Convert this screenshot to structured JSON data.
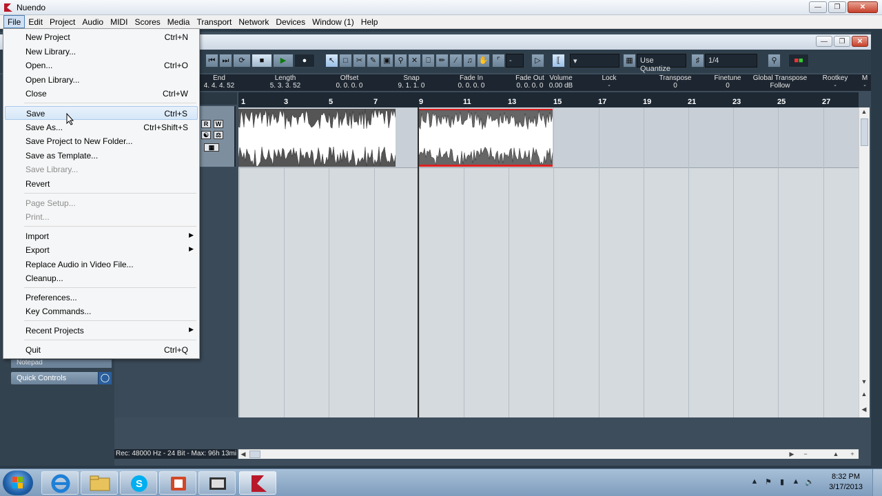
{
  "app": {
    "title": "Nuendo"
  },
  "menubar": {
    "items": [
      "File",
      "Edit",
      "Project",
      "Audio",
      "MIDI",
      "Scores",
      "Media",
      "Transport",
      "Network",
      "Devices",
      "Window (1)",
      "Help"
    ],
    "active": "File"
  },
  "file_menu": {
    "items": [
      {
        "label": "New Project",
        "shortcut": "Ctrl+N"
      },
      {
        "label": "New Library...",
        "shortcut": ""
      },
      {
        "label": "Open...",
        "shortcut": "Ctrl+O"
      },
      {
        "label": "Open Library...",
        "shortcut": ""
      },
      {
        "label": "Close",
        "shortcut": "Ctrl+W"
      },
      {
        "label": "Save",
        "shortcut": "Ctrl+S"
      },
      {
        "label": "Save As...",
        "shortcut": "Ctrl+Shift+S"
      },
      {
        "label": "Save Project to New Folder...",
        "shortcut": ""
      },
      {
        "label": "Save as Template...",
        "shortcut": ""
      },
      {
        "label": "Save Library...",
        "shortcut": ""
      },
      {
        "label": "Revert",
        "shortcut": ""
      },
      {
        "label": "Page Setup...",
        "shortcut": ""
      },
      {
        "label": "Print...",
        "shortcut": ""
      },
      {
        "label": "Import",
        "shortcut": ""
      },
      {
        "label": "Export",
        "shortcut": ""
      },
      {
        "label": "Replace Audio in Video File...",
        "shortcut": ""
      },
      {
        "label": "Cleanup...",
        "shortcut": ""
      },
      {
        "label": "Preferences...",
        "shortcut": ""
      },
      {
        "label": "Key Commands...",
        "shortcut": ""
      },
      {
        "label": "Recent Projects",
        "shortcut": ""
      },
      {
        "label": "Quit",
        "shortcut": "Ctrl+Q"
      }
    ],
    "hovered": "Save",
    "disabled": [
      "Save Library...",
      "Page Setup...",
      "Print..."
    ],
    "submenus": [
      "Import",
      "Export",
      "Recent Projects"
    ]
  },
  "toolbar": {
    "quantize_mode": "Use Quantize",
    "quantize_value": "1/4",
    "snap_dropdown": "-"
  },
  "infoline": {
    "columns": [
      {
        "header": "End",
        "value": "4. 4. 4. 52"
      },
      {
        "header": "Length",
        "value": "5. 3. 3. 52"
      },
      {
        "header": "Offset",
        "value": "0. 0. 0.   0"
      },
      {
        "header": "Snap",
        "value": "9. 1. 1.   0"
      },
      {
        "header": "Fade In",
        "value": "0. 0. 0.   0"
      },
      {
        "header": "Fade Out",
        "value": "0. 0. 0.   0"
      },
      {
        "header": "Volume",
        "value": "0.00 dB"
      },
      {
        "header": "Lock",
        "value": "-"
      },
      {
        "header": "Transpose",
        "value": "0"
      },
      {
        "header": "Finetune",
        "value": "0"
      },
      {
        "header": "Global Transpose",
        "value": "Follow"
      },
      {
        "header": "Rootkey",
        "value": "-"
      },
      {
        "header": "M",
        "value": "-"
      }
    ]
  },
  "ruler": {
    "bars": [
      "1",
      "3",
      "5",
      "7",
      "9",
      "11",
      "13",
      "15",
      "17",
      "19",
      "21",
      "23",
      "25",
      "27"
    ]
  },
  "track": {
    "buttons": [
      "R",
      "W"
    ]
  },
  "inspector": {
    "notepad": "Notepad",
    "quick_controls": "Quick Controls"
  },
  "statusline": {
    "text": "Rec: 48000 Hz - 24 Bit - Max: 96h 13mi"
  },
  "taskbar": {
    "clock_time": "8:32 PM",
    "clock_date": "3/17/2013"
  },
  "icons": {
    "app": "nuendo-logo-icon",
    "start": "windows-start-icon",
    "ie": "internet-explorer-icon",
    "explorer": "folder-icon",
    "skype": "skype-icon",
    "powerpoint": "powerpoint-icon",
    "media": "film-icon",
    "nuendo": "nuendo-logo-icon"
  },
  "colors": {
    "accent": "#4e7eb4",
    "selection_red": "#e02020",
    "project_bg": "#3d4d5b"
  }
}
